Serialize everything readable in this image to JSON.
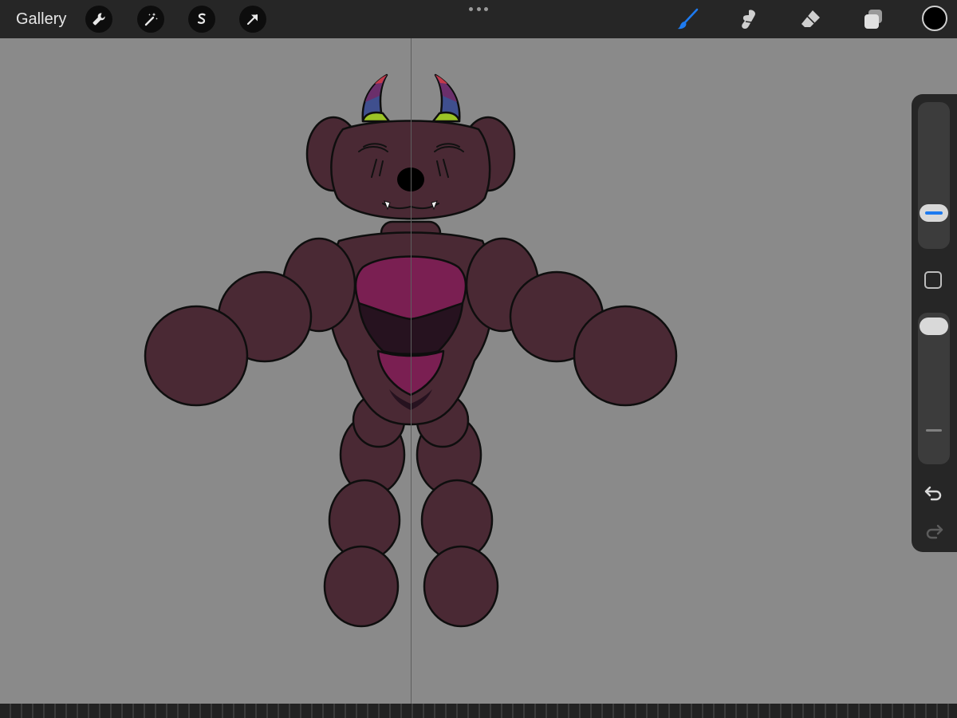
{
  "toolbar": {
    "gallery_label": "Gallery",
    "left_tools": [
      "wrench-icon",
      "magic-wand-icon",
      "selection-icon",
      "transform-arrow-icon"
    ],
    "right_tools": [
      "brush-icon",
      "smudge-icon",
      "eraser-icon",
      "layers-icon"
    ],
    "active_tool": "brush-icon",
    "active_color": "#000000",
    "accent_color": "#1e7bf0"
  },
  "sidebar": {
    "brush_size_level": 0.72,
    "opacity_level": 0.0,
    "modify_button_icon": "square-icon",
    "undo_icon": "undo-arrow-icon",
    "redo_icon": "redo-arrow-icon",
    "redo_enabled": false
  },
  "canvas": {
    "background_color": "#8a8a8a",
    "symmetry_guide": true,
    "drawing": "bear-with-horns",
    "palette": {
      "body": "#4a2934",
      "chest_light": "#7a1f52",
      "chest_dark": "#26121f",
      "horn_red": "#c43a4a",
      "horn_blue": "#3f4f8e",
      "horn_purple": "#6b2f6b",
      "horn_green": "#9bc326",
      "outline": "#0e0e0e"
    }
  }
}
